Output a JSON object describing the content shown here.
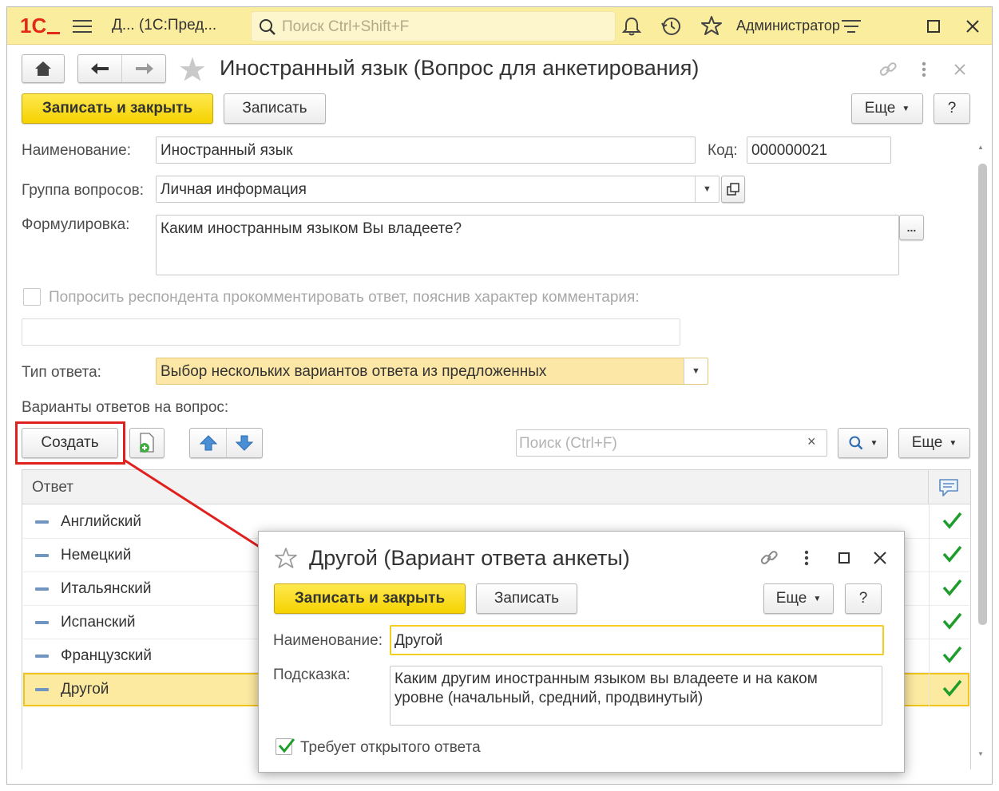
{
  "app": {
    "logo": "1С",
    "title": "Д...  (1С:Пред...",
    "search_placeholder": "Поиск Ctrl+Shift+F",
    "user": "Администратор"
  },
  "form": {
    "title": "Иностранный язык (Вопрос для анкетирования)",
    "save_close_label": "Записать и закрыть",
    "save_label": "Записать",
    "more_label": "Еще",
    "help_label": "?",
    "name_label": "Наименование:",
    "name_value": "Иностранный язык",
    "code_label": "Код:",
    "code_value": "000000021",
    "group_label": "Группа вопросов:",
    "group_value": "Личная информация",
    "wording_label": "Формулировка:",
    "wording_value": "Каким иностранным языком Вы владеете?",
    "wording_button": "...",
    "comment_checkbox_label": "Попросить респондента прокомментировать ответ, пояснив характер комментария:",
    "comment_checked": false,
    "comment_value": "",
    "answer_type_label": "Тип ответа:",
    "answer_type_value": "Выбор нескольких вариантов ответа из предложенных",
    "answers_label": "Варианты ответов на вопрос:"
  },
  "answers_toolbar": {
    "create_label": "Создать",
    "search_placeholder": "Поиск (Ctrl+F)",
    "clear_label": "×",
    "more_label": "Еще"
  },
  "table": {
    "column_header": "Ответ",
    "rows": [
      {
        "label": "Английский",
        "checked": true
      },
      {
        "label": "Немецкий",
        "checked": true
      },
      {
        "label": "Итальянский",
        "checked": true
      },
      {
        "label": "Испанский",
        "checked": true
      },
      {
        "label": "Французский",
        "checked": true
      },
      {
        "label": "Другой",
        "checked": true,
        "selected": true
      }
    ]
  },
  "popup": {
    "title": "Другой (Вариант ответа анкеты)",
    "save_close_label": "Записать и закрыть",
    "save_label": "Записать",
    "more_label": "Еще",
    "help_label": "?",
    "name_label": "Наименование:",
    "name_value": "Другой",
    "hint_label": "Подсказка:",
    "hint_value_line1": "Каким другим иностранным языком вы владеете и на каком",
    "hint_value_line2": "уровне (начальный, средний, продвинутый)",
    "open_answer_label": "Требует открытого ответа",
    "open_answer_checked": true
  },
  "colors": {
    "titlebar_bg": "#fbed9e",
    "accent_yellow": "#f5d200",
    "selected_row_bg": "#fdeaa1",
    "highlight_red": "#e0201d",
    "check_green": "#1f9d2c",
    "answer_type_bg": "#fde7a6"
  },
  "icons": {
    "titlebar": [
      "menu-icon",
      "search-icon",
      "bell-icon",
      "history-icon",
      "star-icon",
      "settings-icon",
      "maximize-icon",
      "close-icon"
    ],
    "form": [
      "home-icon",
      "back-arrow-icon",
      "forward-arrow-icon",
      "favorite-star-icon",
      "link-icon",
      "more-icon",
      "close-icon"
    ],
    "table": [
      "add-from-template-icon",
      "move-up-icon",
      "move-down-icon",
      "search-icon",
      "comment-icon",
      "check-icon"
    ]
  }
}
